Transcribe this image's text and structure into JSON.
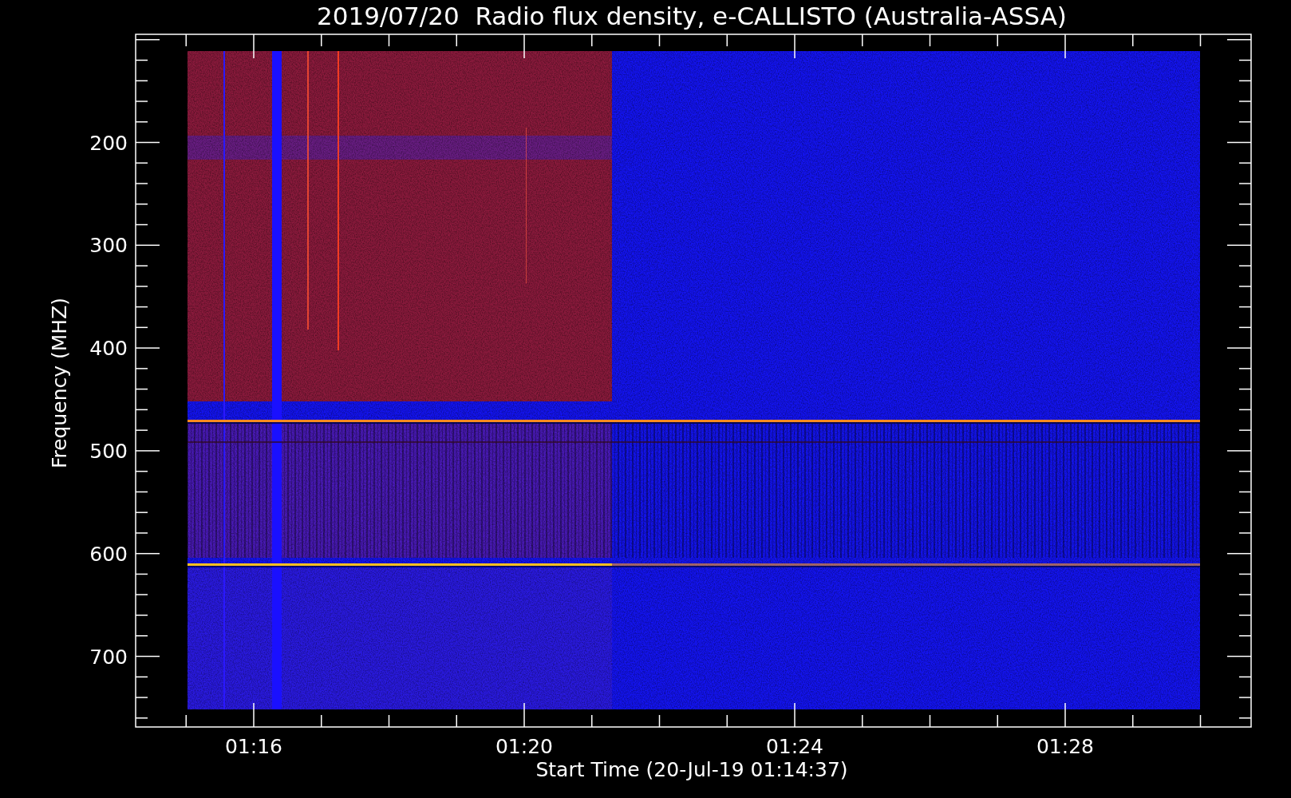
{
  "title": "2019/07/20  Radio flux density, e-CALLISTO (Australia-ASSA)",
  "x_axis": {
    "label": "Start Time (20-Jul-19 01:14:37)",
    "tick_labels": [
      "01:16",
      "01:20",
      "01:24",
      "01:28"
    ]
  },
  "y_axis": {
    "label": "Frequency (MHZ)",
    "tick_labels": [
      "200",
      "300",
      "400",
      "500",
      "600",
      "700"
    ]
  }
}
